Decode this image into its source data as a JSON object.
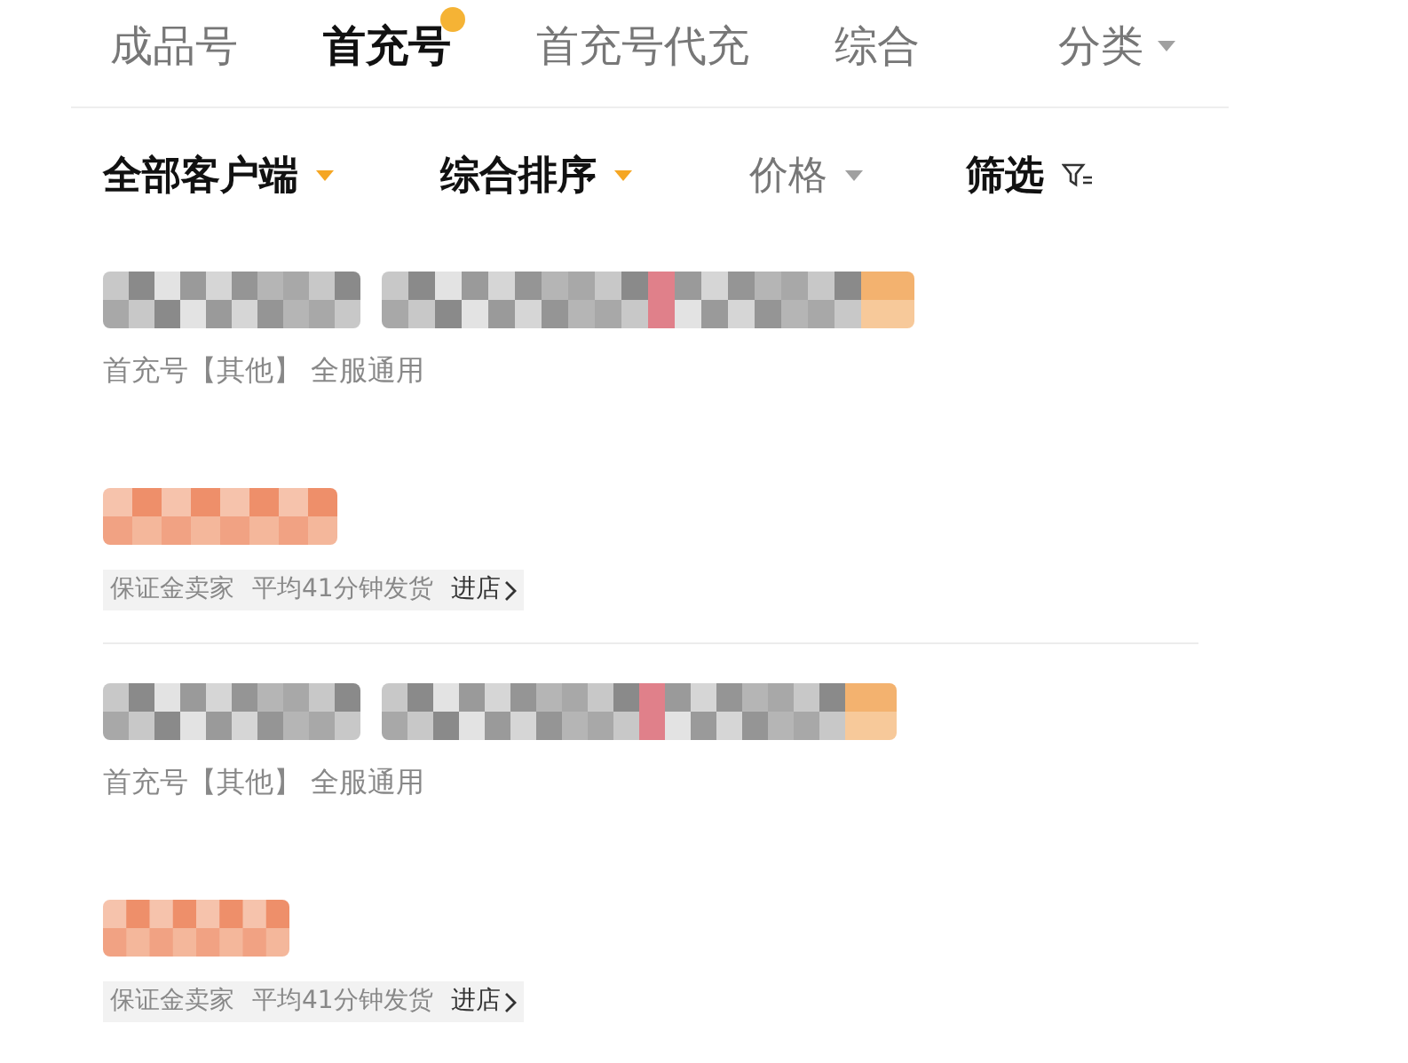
{
  "tabs": [
    {
      "label": "成品号",
      "selected": false,
      "kind": "tab"
    },
    {
      "label": "首充号",
      "selected": true,
      "kind": "tab"
    },
    {
      "label": "首充号代充",
      "selected": false,
      "kind": "tab"
    },
    {
      "label": "综合",
      "selected": false,
      "kind": "tab"
    },
    {
      "label": "分类",
      "selected": false,
      "kind": "dropdown"
    }
  ],
  "filters": [
    {
      "label": "全部客户端",
      "selected": true,
      "kind": "dropdown"
    },
    {
      "label": "综合排序",
      "selected": true,
      "kind": "dropdown"
    },
    {
      "label": "价格",
      "selected": false,
      "kind": "dropdown"
    },
    {
      "label": "筛选",
      "selected": true,
      "kind": "filter"
    }
  ],
  "listings": [
    {
      "subtitle": "首充号【其他】 全服通用",
      "seller_tag": "保证金卖家",
      "shipping": "平均41分钟发货",
      "store_link": "进店"
    },
    {
      "subtitle": "首充号【其他】 全服通用",
      "seller_tag": "保证金卖家",
      "shipping": "平均41分钟发货",
      "store_link": "进店"
    }
  ]
}
